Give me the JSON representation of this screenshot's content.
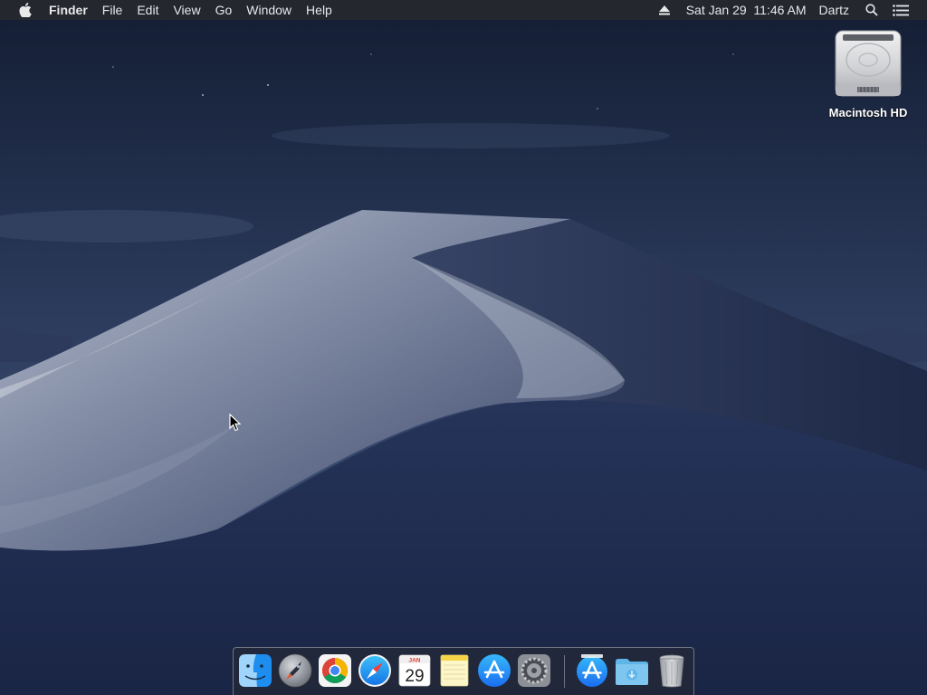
{
  "menubar": {
    "app_name": "Finder",
    "menus": [
      "File",
      "Edit",
      "View",
      "Go",
      "Window",
      "Help"
    ],
    "clock": "Sat Jan 29  11:46 AM",
    "user": "Dartz",
    "icons": [
      "apple-logo-icon",
      "eject-icon",
      "spotlight-search-icon",
      "notification-center-icon"
    ]
  },
  "desktop": {
    "drive_label": "Macintosh HD",
    "drive_icon": "hard-drive-icon"
  },
  "dock": {
    "apps": [
      {
        "name": "Finder",
        "icon": "finder-icon",
        "running": true
      },
      {
        "name": "Launchpad",
        "icon": "launchpad-icon",
        "running": false
      },
      {
        "name": "Google Chrome",
        "icon": "chrome-icon",
        "running": false
      },
      {
        "name": "Safari",
        "icon": "safari-icon",
        "running": false
      },
      {
        "name": "Calendar",
        "icon": "calendar-icon",
        "running": false
      },
      {
        "name": "Notes",
        "icon": "notes-icon",
        "running": false
      },
      {
        "name": "App Store",
        "icon": "app-store-icon",
        "running": false
      },
      {
        "name": "System Preferences",
        "icon": "system-preferences-icon",
        "running": false
      },
      {
        "name": "Applications",
        "icon": "app-store-folder-icon",
        "running": false
      },
      {
        "name": "Downloads",
        "icon": "downloads-folder-icon",
        "running": false
      },
      {
        "name": "Trash",
        "icon": "trash-icon",
        "running": false
      }
    ],
    "calendar_month": "JAN",
    "calendar_day": "29"
  },
  "colors": {
    "menubar_bg": "#26282e",
    "sky_top": "#16213a",
    "sky_mid": "#344567",
    "dune_light": "#a9b1c3",
    "dune_dark": "#1f2b4a"
  }
}
